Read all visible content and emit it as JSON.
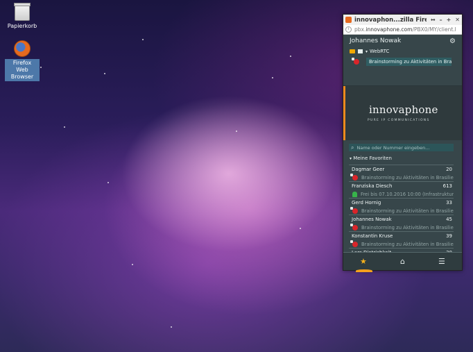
{
  "desktop": {
    "icons": [
      {
        "label": "Papierkorb"
      },
      {
        "label": "Firefox Web Browser"
      }
    ]
  },
  "window": {
    "title": "innovaphon...zilla Firefox",
    "controls": [
      "↔",
      "–",
      "+",
      "✕"
    ],
    "url_prefix": "pbx.",
    "url_domain": "innovaphone.com",
    "url_path": "/PBX0/MY/client.l"
  },
  "app": {
    "user_name": "Johannes Nowak",
    "webrtc_label": "WebRTC",
    "status_note": "Brainstorming zu Aktivitäten in Bras",
    "brand": "innovaphone",
    "tagline": "PURE IP COMMUNICATIONS",
    "search_placeholder": "Name oder Nummer eingeben...",
    "favorites_header": "Meine Favoriten",
    "favorites": [
      {
        "name": "Dagmar Geer",
        "number": "20",
        "note": "Brainstorming zu Aktivitäten in Brasilien,",
        "status": "busy"
      },
      {
        "name": "Franziska Diesch",
        "number": "613",
        "note": "Frei bis 07.10.2016 10:00 (Infrastruktur Mi",
        "status": "available"
      },
      {
        "name": "Gerd Hornig",
        "number": "33",
        "note": "Brainstorming zu Aktivitäten in Brasilien,",
        "status": "busy"
      },
      {
        "name": "Johannes Nowak",
        "number": "45",
        "note": "Brainstorming zu Aktivitäten in Brasilien,",
        "status": "busy"
      },
      {
        "name": "Konstantin Kruse",
        "number": "39",
        "note": "Brainstorming zu Aktivitäten in Brasilien,",
        "status": "busy"
      },
      {
        "name": "Lars Dietrichkeit",
        "number": "30",
        "note": "",
        "status": ""
      }
    ],
    "accent_orange": "#f08a1e",
    "busy_red": "#d9252a",
    "available_green": "#37b34a"
  }
}
